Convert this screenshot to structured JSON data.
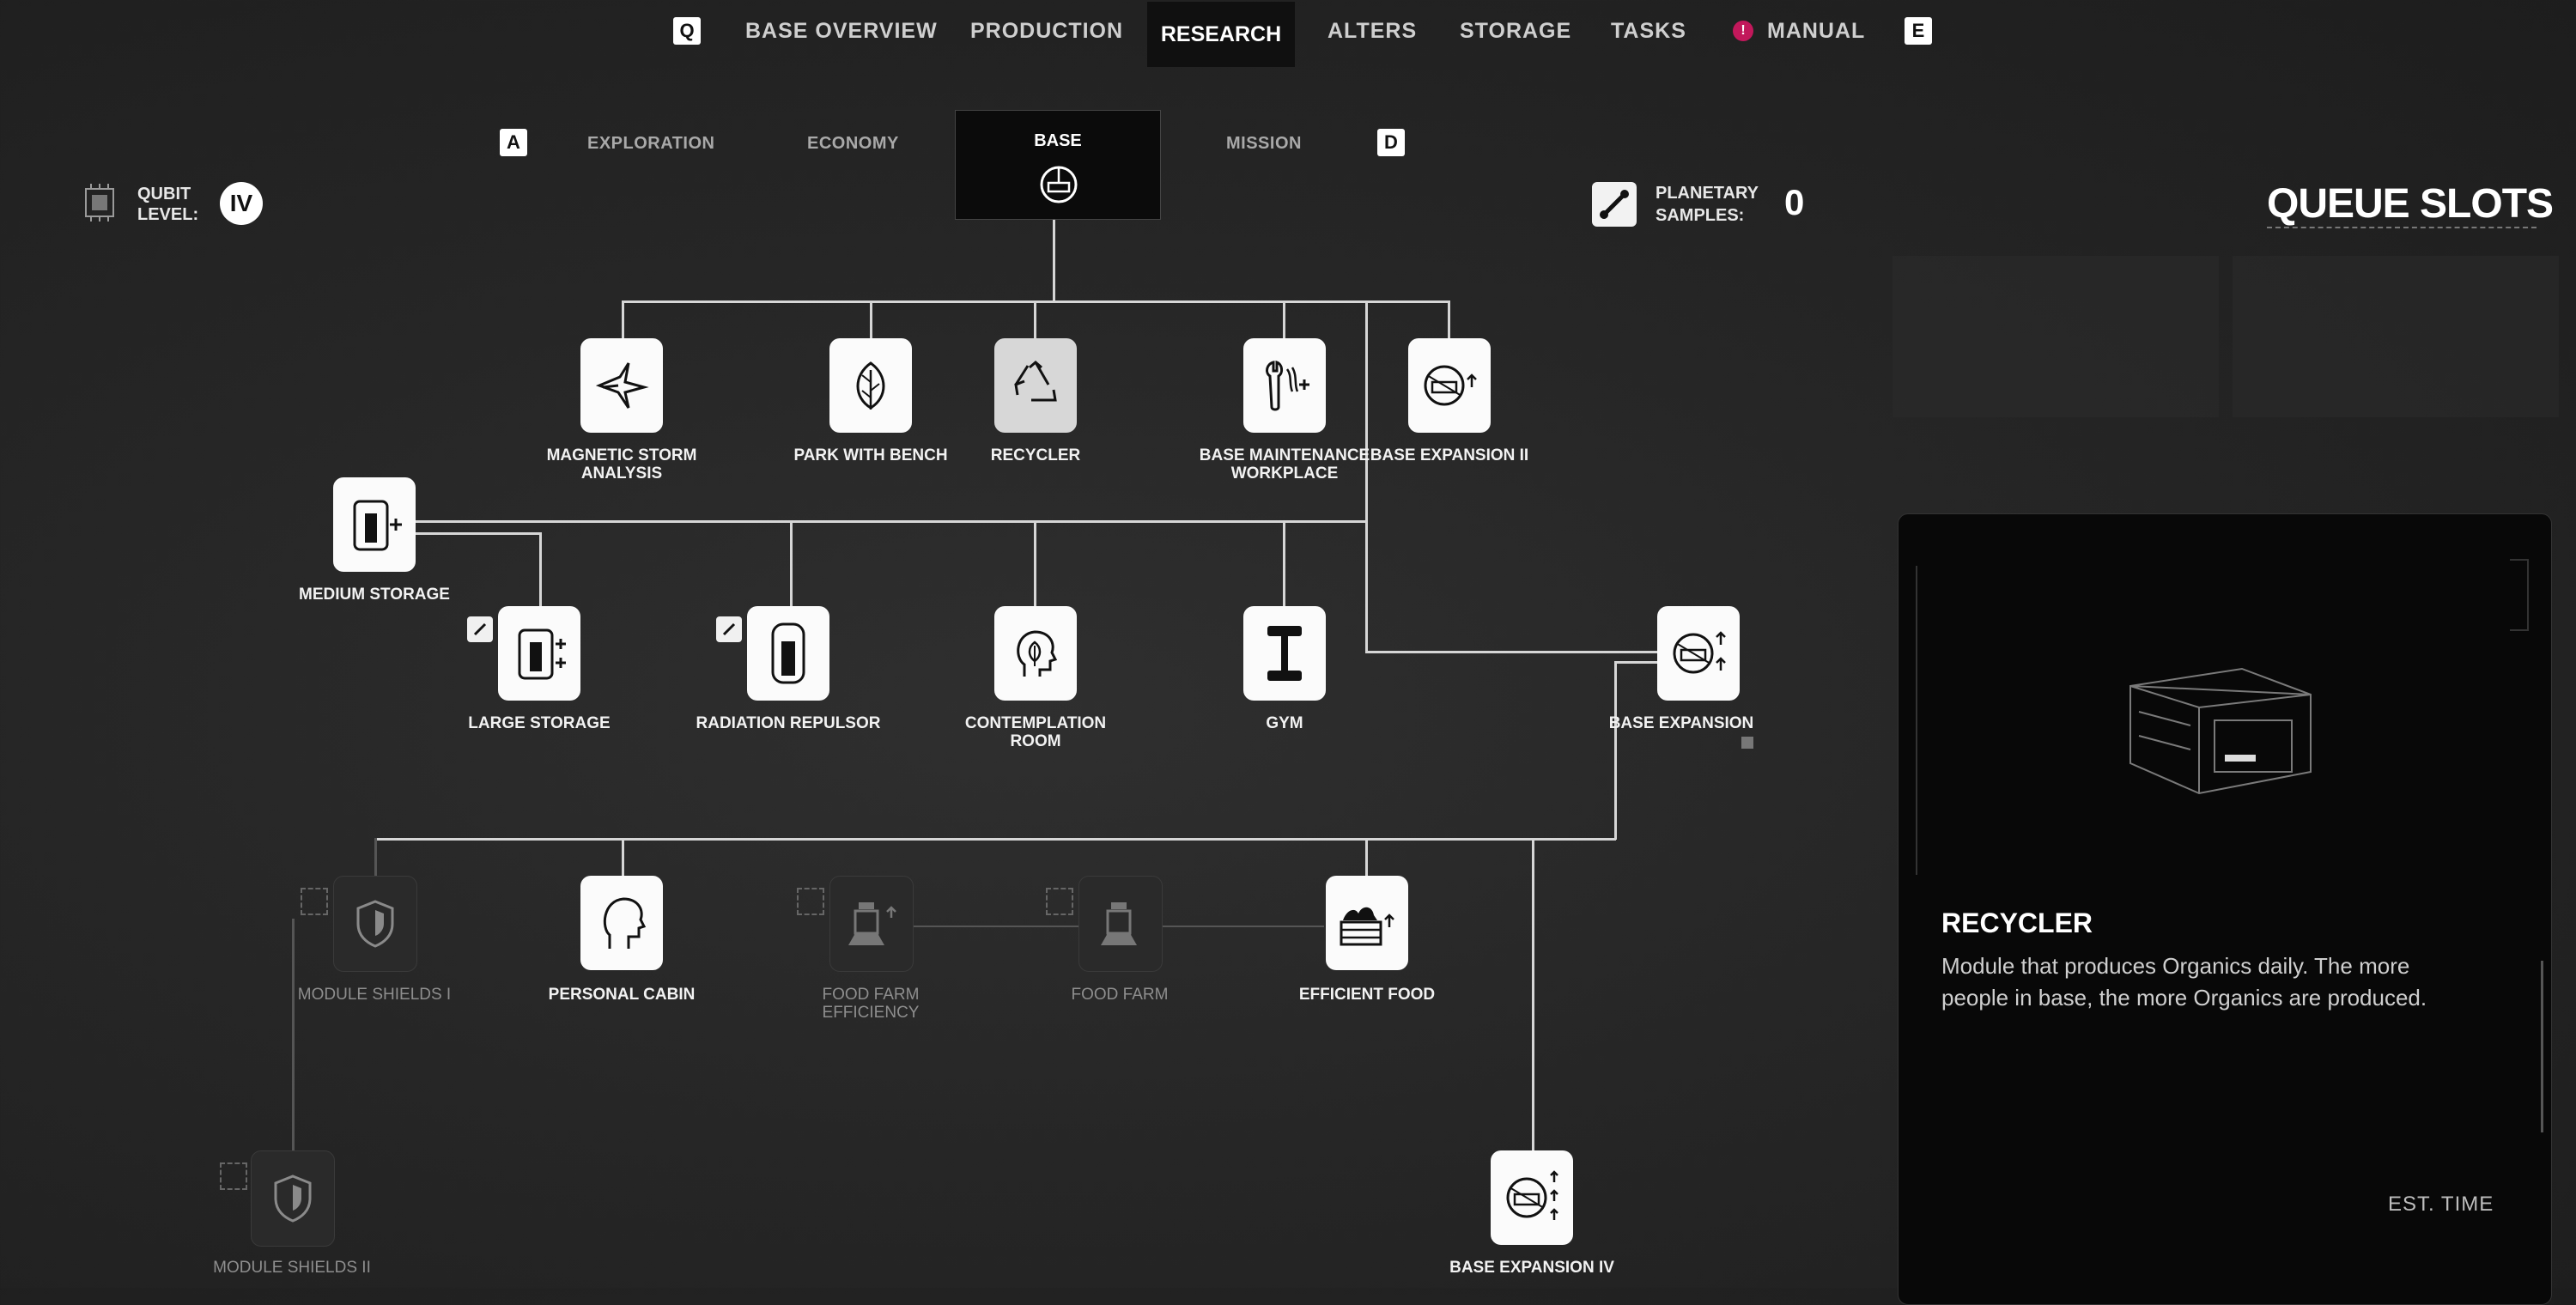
{
  "top_nav": {
    "prev_key": "Q",
    "next_key": "E",
    "items": [
      "BASE OVERVIEW",
      "PRODUCTION",
      "RESEARCH",
      "ALTERS",
      "STORAGE",
      "TASKS",
      "MANUAL"
    ],
    "active": "RESEARCH",
    "manual_badge": "!"
  },
  "sub_tabs": {
    "prev_key": "A",
    "next_key": "D",
    "items": [
      "EXPLORATION",
      "ECONOMY",
      "BASE",
      "MISSION"
    ],
    "active": "BASE"
  },
  "qubit": {
    "label_1": "QUBIT",
    "label_2": "LEVEL:",
    "value": "IV"
  },
  "samples": {
    "label_1": "PLANETARY",
    "label_2": "SAMPLES:",
    "value": "0"
  },
  "queue": {
    "title": "QUEUE SLOTS"
  },
  "nodes": {
    "magnetic": {
      "label": "MAGNETIC STORM ANALYSIS",
      "icon": "magnetic-storm-icon"
    },
    "park": {
      "label": "PARK WITH BENCH",
      "icon": "leaf-icon"
    },
    "recycler": {
      "label": "RECYCLER",
      "icon": "recycle-icon"
    },
    "maintenance": {
      "label": "BASE MAINTENANCE WORKPLACE",
      "icon": "wrench-icon"
    },
    "expansion2": {
      "label": "BASE EXPANSION II",
      "icon": "base-expansion-icon"
    },
    "medium_storage": {
      "label": "MEDIUM STORAGE",
      "icon": "storage-icon"
    },
    "large_storage": {
      "label": "LARGE STORAGE",
      "icon": "storage-icon"
    },
    "radiation": {
      "label": "RADIATION REPULSOR",
      "icon": "repulsor-icon"
    },
    "contemplation": {
      "label": "CONTEMPLATION ROOM",
      "icon": "head-leaf-icon"
    },
    "gym": {
      "label": "GYM",
      "icon": "dumbbell-icon"
    },
    "expansion3": {
      "label": "BASE EXPANSION",
      "icon": "base-expansion-icon"
    },
    "shields1": {
      "label": "MODULE SHIELDS I",
      "icon": "shield-icon"
    },
    "cabin": {
      "label": "PERSONAL CABIN",
      "icon": "person-head-icon"
    },
    "farm_eff": {
      "label": "FOOD FARM EFFICIENCY",
      "icon": "food-farm-icon"
    },
    "farm": {
      "label": "FOOD FARM",
      "icon": "food-farm-icon"
    },
    "efficient_food": {
      "label": "EFFICIENT FOOD",
      "icon": "food-crate-icon"
    },
    "shields2": {
      "label": "MODULE SHIELDS II",
      "icon": "shield-icon"
    },
    "expansion4": {
      "label": "BASE EXPANSION IV",
      "icon": "base-expansion-icon"
    }
  },
  "detail": {
    "title": "RECYCLER",
    "description": "Module that produces Organics daily. The more people in base, the more Organics are produced.",
    "est_time_label": "EST. TIME"
  },
  "colors": {
    "background": "#262626",
    "tile": "#fbfbfb",
    "panel": "#080808",
    "accent": "#c2185b"
  }
}
